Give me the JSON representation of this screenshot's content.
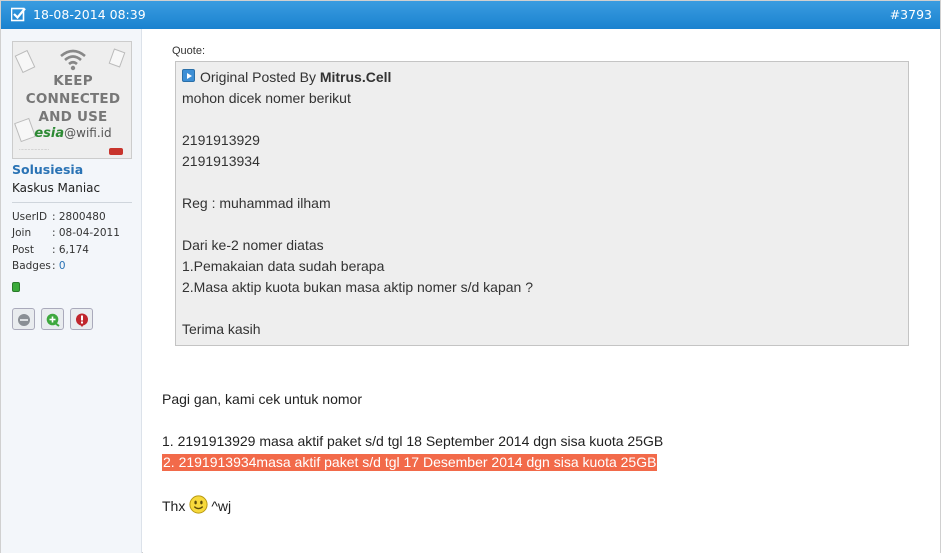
{
  "header": {
    "date": "18-08-2014 08:39",
    "post_number": "#3793"
  },
  "user": {
    "avatar_text": {
      "line1": "KEEP",
      "line2": "CONNECTED",
      "line3": "AND USE",
      "brand_esia": "esia",
      "brand_suffix": "@wifi.id"
    },
    "username": "Solusiesia",
    "title": "Kaskus Maniac",
    "info": [
      {
        "label": "UserID",
        "value": ": 2800480"
      },
      {
        "label": "Join",
        "value": ": 08-04-2011"
      },
      {
        "label": "Post",
        "value": ": 6,174"
      },
      {
        "label": "Badges",
        "value": ": ",
        "link": "0"
      }
    ],
    "status_color": "#3bab3b"
  },
  "quote": {
    "label": "Quote:",
    "prefix": "Original Posted By ",
    "author": "Mitrus.Cell",
    "lines": [
      "mohon dicek nomer berikut",
      "",
      "2191913929",
      "2191913934",
      "",
      "Reg : muhammad ilham",
      "",
      "Dari ke-2 nomer diatas",
      "1.Pemakaian data sudah berapa",
      "2.Masa aktip kuota bukan masa aktip nomer s/d kapan ?",
      "",
      "Terima kasih"
    ]
  },
  "message": {
    "greeting": "Pagi gan, kami cek untuk nomor",
    "item1": "1. 2191913929 masa aktif paket s/d tgl 18 September 2014 dgn sisa kuota 25GB",
    "item2": "2. 2191913934masa aktif paket s/d tgl 17 Desember 2014 dgn sisa kuota 25GB",
    "closing_before": "Thx",
    "closing_after": "^wj",
    "highlight_color": "#f26a4a"
  },
  "icons": {
    "header_check": "checkbox-icon",
    "quote_arrow": "quote-arrow-icon",
    "smiley": "smiley-icon",
    "btn1": "ignore-user-icon",
    "btn2": "add-reputation-icon",
    "btn3": "report-icon"
  }
}
